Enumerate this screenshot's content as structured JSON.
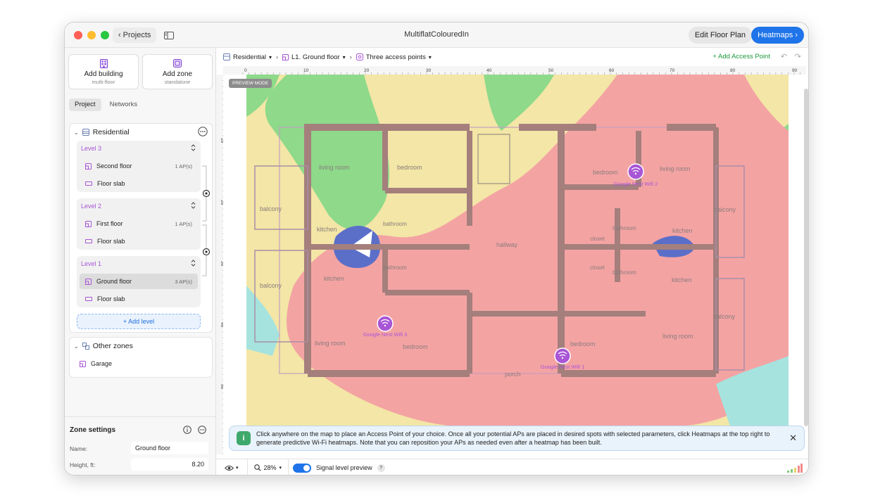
{
  "window": {
    "title": "MultiflatColouredIn",
    "projects_label": "Projects",
    "edit_floor_plan_label": "Edit Floor Plan",
    "heatmaps_label": "Heatmaps"
  },
  "sidebar": {
    "add_building": {
      "title": "Add building",
      "subtitle": "multi-floor"
    },
    "add_zone": {
      "title": "Add zone",
      "subtitle": "standalone"
    },
    "tabs": [
      "Project",
      "Networks"
    ],
    "building": {
      "name": "Residential",
      "levels": [
        {
          "title": "Level 3",
          "floor": "Second floor",
          "aps": "1 AP(s)",
          "slab": "Floor slab"
        },
        {
          "title": "Level 2",
          "floor": "First floor",
          "aps": "1 AP(s)",
          "slab": "Floor slab"
        },
        {
          "title": "Level 1",
          "floor": "Ground floor",
          "aps": "3 AP(s)",
          "slab": "Floor slab"
        }
      ],
      "add_level_label": "+ Add level"
    },
    "other_zones": {
      "title": "Other zones",
      "items": [
        "Garage"
      ]
    },
    "zone_settings": {
      "title": "Zone settings",
      "name_label": "Name:",
      "name_value": "Ground floor",
      "height_label": "Height, ft:",
      "height_value": "8.20"
    }
  },
  "breadcrumb": {
    "building": "Residential",
    "floor": "L1. Ground floor",
    "scenario": "Three access points"
  },
  "toolbar": {
    "add_ap_label": "+ Add Access Point"
  },
  "ruler": {
    "top_ticks": [
      "0",
      "10",
      "20",
      "30",
      "40",
      "50",
      "60",
      "70",
      "80",
      "90"
    ],
    "left_ticks": [
      "10",
      "20",
      "30",
      "40",
      "50"
    ]
  },
  "map": {
    "preview_badge": "PREVIEW MODE",
    "rooms": [
      "living room",
      "bedroom",
      "living room",
      "bedroom",
      "balcony",
      "kitchen",
      "bathroom",
      "hallway",
      "bathroom",
      "closet",
      "kitchen",
      "balcony",
      "closet",
      "bathroom",
      "balcony",
      "kitchen",
      "bathroom",
      "kitchen",
      "balcony",
      "living room",
      "bedroom",
      "bedroom",
      "living room",
      "porch"
    ],
    "access_points": [
      "Google Nest Wifi 2",
      "Google Nest Wifi 3",
      "Google Nest Wifi 1"
    ],
    "colors": {
      "red": "#f4a3a3",
      "yellow": "#f3e6a6",
      "green": "#8ed98a",
      "cyan": "#a6e3de",
      "blue": "#5b6fc9",
      "wall": "#a47f7c",
      "ap": "#a855d6"
    }
  },
  "info_toast": {
    "text": "Click anywhere on the map to place an Access Point of your choice. Once all your potential APs are placed in desired spots with selected parameters, click Heatmaps at the top right to generate predictive Wi-Fi heatmaps. Note that you can reposition your APs as needed even after a heatmap has been built."
  },
  "bottombar": {
    "zoom": "28%",
    "signal_label": "Signal level preview",
    "help": "?"
  }
}
